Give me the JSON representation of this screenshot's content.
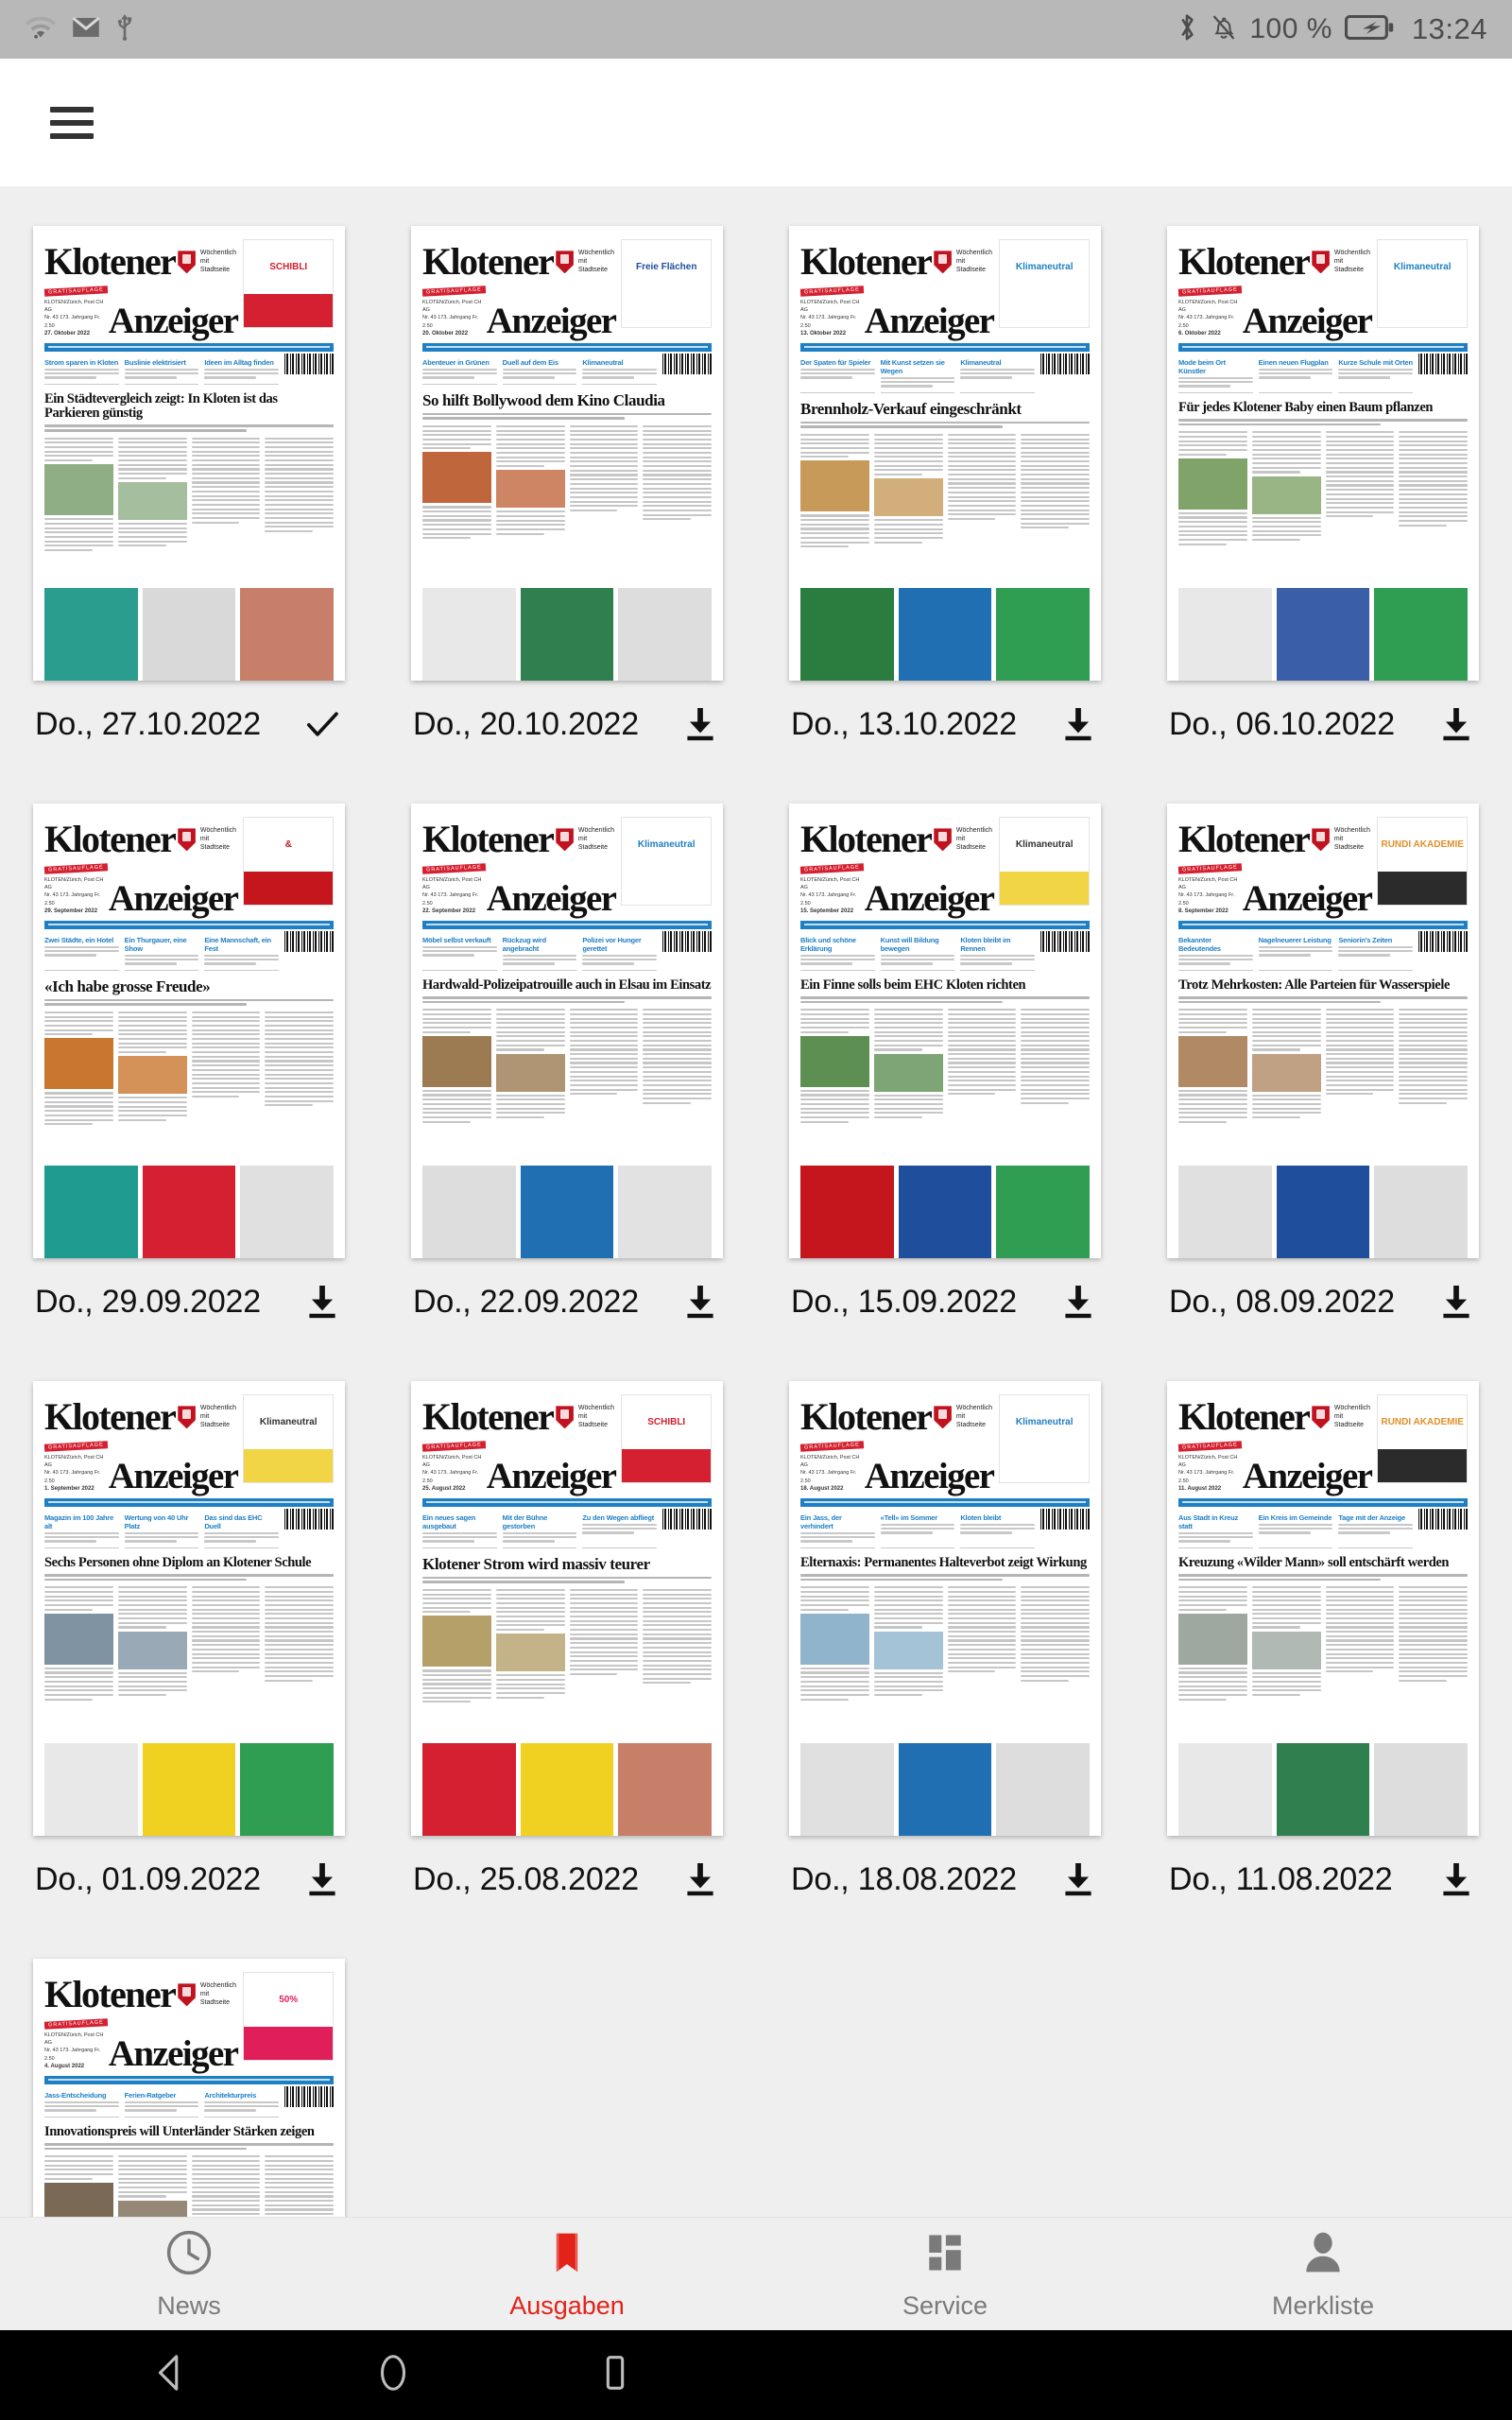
{
  "statusbar": {
    "icons_left": [
      "wifi-icon",
      "mail-icon",
      "usb-icon"
    ],
    "icons_right": [
      "bluetooth-icon",
      "bell-muted-icon",
      "battery-charging-icon"
    ],
    "battery_text": "100 %",
    "time": "13:24"
  },
  "appbar": {
    "menu_icon": "hamburger-menu-icon"
  },
  "masthead": {
    "word1": "Klotener",
    "word2": "Anzeiger",
    "ribbon": "GRATISAUFLAGE",
    "tagline_line1": "Wöchentlich",
    "tagline_line2": "mit Stadtseite"
  },
  "accent": {
    "brand_red": "#e2231a",
    "masthead_red": "#c1121f",
    "teaser_blue": "#1f7fc4",
    "status_gray": "#b8b8b8"
  },
  "issues": [
    {
      "date": "Do., 27.10.2022",
      "action": "check",
      "action_icon": "check-icon",
      "issue_date_label": "27. Oktober 2022",
      "headline": "Ein Städtevergleich zeigt: In Kloten ist das Parkieren günstig",
      "teasers": [
        "Strom sparen in Kloten",
        "Buslinie elektrisiert",
        "Ideen im Alltag finden"
      ],
      "ad_label": "SCHIBLI",
      "ad_color": "#d42030",
      "ad_text_color": "#d42030",
      "photo_color": "#8fae86",
      "foot_colors": [
        "#2a9d8f",
        "#d9d9d9",
        "#c87f6a"
      ]
    },
    {
      "date": "Do., 20.10.2022",
      "action": "download",
      "action_icon": "download-icon",
      "issue_date_label": "20. Oktober 2022",
      "headline": "So hilft Bollywood dem Kino Claudia",
      "teasers": [
        "Abenteuer in Grünen",
        "Duell auf dem Eis",
        "Klimaneutral"
      ],
      "ad_label": "Freie Flächen",
      "ad_color": "#ffffff",
      "ad_text_color": "#1f4e9c",
      "photo_color": "#c0663c",
      "foot_colors": [
        "#e8e8e8",
        "#2f7f4f",
        "#dddddd"
      ]
    },
    {
      "date": "Do., 13.10.2022",
      "action": "download",
      "action_icon": "download-icon",
      "issue_date_label": "13. Oktober 2022",
      "headline": "Brennholz-Verkauf eingeschränkt",
      "teasers": [
        "Der Spaten für Spieler",
        "Mit Kunst setzen sie Wegen",
        "Klimaneutral"
      ],
      "ad_label": "Klimaneutral",
      "ad_color": "#ffffff",
      "ad_text_color": "#1f7fc4",
      "photo_color": "#c79a5a",
      "foot_colors": [
        "#2a7d3f",
        "#1f6fb2",
        "#2f9e52"
      ]
    },
    {
      "date": "Do., 06.10.2022",
      "action": "download",
      "action_icon": "download-icon",
      "issue_date_label": "6. Oktober 2022",
      "headline": "Für jedes Klotener Baby einen Baum pflanzen",
      "teasers": [
        "Mode beim Ort Künstler",
        "Einen neuen Flugplan",
        "Kurze Schule mit Orten"
      ],
      "ad_label": "Klimaneutral",
      "ad_color": "#ffffff",
      "ad_text_color": "#1f7fc4",
      "photo_color": "#7fa368",
      "foot_colors": [
        "#e8e8e8",
        "#3b5ea8",
        "#2f9e52"
      ]
    },
    {
      "date": "Do., 29.09.2022",
      "action": "download",
      "action_icon": "download-icon",
      "issue_date_label": "29. September 2022",
      "headline": "«Ich habe grosse Freude»",
      "teasers": [
        "Zwei Städte, ein Hotel",
        "Ein Thurgauer, eine Show",
        "Eine Mannschaft, ein Fest"
      ],
      "ad_label": "&",
      "ad_color": "#c4161c",
      "ad_text_color": "#c4161c",
      "photo_color": "#c9772f",
      "foot_colors": [
        "#1f9c8f",
        "#d42030",
        "#e0e0e0"
      ]
    },
    {
      "date": "Do., 22.09.2022",
      "action": "download",
      "action_icon": "download-icon",
      "issue_date_label": "22. September 2022",
      "headline": "Hardwald-Polizeipatrouille auch in Elsau im Einsatz",
      "teasers": [
        "Möbel selbst verkauft",
        "Rückzug wird angebracht",
        "Polizei vor Hunger gerettet"
      ],
      "ad_label": "Klimaneutral",
      "ad_color": "#ffffff",
      "ad_text_color": "#1f7fc4",
      "photo_color": "#9c7b52",
      "foot_colors": [
        "#dddddd",
        "#1f6fb2",
        "#e2e2e2"
      ]
    },
    {
      "date": "Do., 15.09.2022",
      "action": "download",
      "action_icon": "download-icon",
      "issue_date_label": "15. September 2022",
      "headline": "Ein Finne solls beim EHC Kloten richten",
      "teasers": [
        "Blick und schöne Erklärung",
        "Kunst will Bildung bewegen",
        "Kloten bleibt im Rennen"
      ],
      "ad_label": "Klimaneutral",
      "ad_color": "#f2d544",
      "ad_text_color": "#333333",
      "photo_color": "#5e8f52",
      "foot_colors": [
        "#c4161c",
        "#1f4e9c",
        "#2f9e52"
      ]
    },
    {
      "date": "Do., 08.09.2022",
      "action": "download",
      "action_icon": "download-icon",
      "issue_date_label": "8. September 2022",
      "headline": "Trotz Mehrkosten: Alle Parteien für Wasserspiele",
      "teasers": [
        "Bekannter Bedeutendes",
        "Nagelneuerer Leistung",
        "Seniorin's Zeiten"
      ],
      "ad_label": "RUNDI AKADEMIE",
      "ad_color": "#2b2b2b",
      "ad_text_color": "#e0902a",
      "photo_color": "#b08a64",
      "foot_colors": [
        "#e0e0e0",
        "#1f4e9c",
        "#dddddd"
      ]
    },
    {
      "date": "Do., 01.09.2022",
      "action": "download",
      "action_icon": "download-icon",
      "issue_date_label": "1. September 2022",
      "headline": "Sechs Personen ohne Diplom an Klotener Schule",
      "teasers": [
        "Magazin im 100 Jahre alt",
        "Wertung von 40 Uhr Platz",
        "Das sind das EHC Duell"
      ],
      "ad_label": "Klimaneutral",
      "ad_color": "#f2d544",
      "ad_text_color": "#333333",
      "photo_color": "#7f93a3",
      "foot_colors": [
        "#e8e8e8",
        "#f0d020",
        "#2f9e52"
      ]
    },
    {
      "date": "Do., 25.08.2022",
      "action": "download",
      "action_icon": "download-icon",
      "issue_date_label": "25. August 2022",
      "headline": "Klotener Strom wird massiv teurer",
      "teasers": [
        "Ein neues sagen ausgebaut",
        "Mit der Bühne gestorben",
        "Zu den Wegen abfliegt"
      ],
      "ad_label": "SCHIBLI",
      "ad_color": "#d42030",
      "ad_text_color": "#d42030",
      "photo_color": "#b5a06a",
      "foot_colors": [
        "#d42030",
        "#f0d020",
        "#c87f6a"
      ]
    },
    {
      "date": "Do., 18.08.2022",
      "action": "download",
      "action_icon": "download-icon",
      "issue_date_label": "18. August 2022",
      "headline": "Elternaxis: Permanentes Halteverbot zeigt Wirkung",
      "teasers": [
        "Ein Jass, der verhindert",
        "«Tell» im Sommer",
        "Kloten bleibt"
      ],
      "ad_label": "Klimaneutral",
      "ad_color": "#ffffff",
      "ad_text_color": "#1f7fc4",
      "photo_color": "#8fb4cc",
      "foot_colors": [
        "#e0e0e0",
        "#1f6fb2",
        "#dddddd"
      ]
    },
    {
      "date": "Do., 11.08.2022",
      "action": "download",
      "action_icon": "download-icon",
      "issue_date_label": "11. August 2022",
      "headline": "Kreuzung «Wilder Mann» soll entschärft werden",
      "teasers": [
        "Aus Stadt in Kreuz statt",
        "Ein Kreis im Gemeinde",
        "Tage mit der Anzeige"
      ],
      "ad_label": "RUNDI AKADEMIE",
      "ad_color": "#2b2b2b",
      "ad_text_color": "#e0902a",
      "photo_color": "#9ca8a0",
      "foot_colors": [
        "#e8e8e8",
        "#2f7f4f",
        "#dddddd"
      ]
    },
    {
      "date": "",
      "action": "none",
      "action_icon": "",
      "issue_date_label": "4. August 2022",
      "headline": "Innovationspreis will Unterländer Stärken zeigen",
      "teasers": [
        "Jass-Entscheidung",
        "Ferien-Ratgeber",
        "Architekturpreis"
      ],
      "ad_label": "50%",
      "ad_color": "#e01f5a",
      "ad_text_color": "#e01f5a",
      "photo_color": "#7a6a55",
      "foot_colors": [
        "#dddddd",
        "#e8e8e8",
        "#dddddd"
      ]
    }
  ],
  "bottom_nav": [
    {
      "label": "News",
      "icon": "clock-icon",
      "active": false
    },
    {
      "label": "Ausgaben",
      "icon": "book-icon",
      "active": true
    },
    {
      "label": "Service",
      "icon": "grid-icon",
      "active": false
    },
    {
      "label": "Merkliste",
      "icon": "person-icon",
      "active": false
    }
  ],
  "android_nav": {
    "back": "back-triangle-icon",
    "home": "home-circle-icon",
    "recents": "recents-square-icon"
  }
}
